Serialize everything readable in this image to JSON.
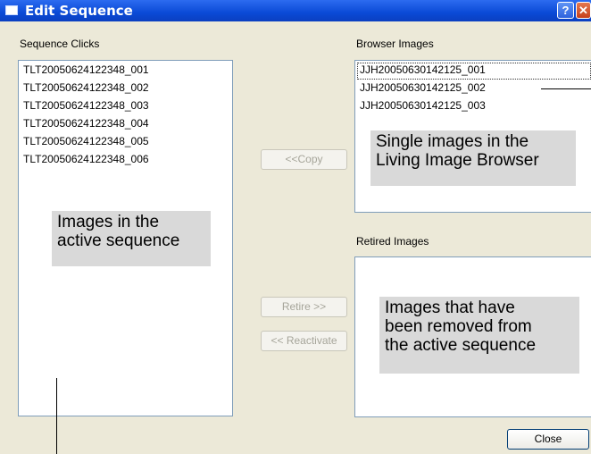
{
  "window": {
    "title": "Edit Sequence",
    "help_glyph": "?",
    "close_glyph": "✕"
  },
  "sequence_clicks": {
    "label": "Sequence Clicks",
    "items": [
      "TLT20050624122348_001",
      "TLT20050624122348_002",
      "TLT20050624122348_003",
      "TLT20050624122348_004",
      "TLT20050624122348_005",
      "TLT20050624122348_006"
    ]
  },
  "browser_images": {
    "label": "Browser Images",
    "items": [
      "JJH20050630142125_001",
      "JJH20050630142125_002",
      "JJH20050630142125_003"
    ]
  },
  "retired_images": {
    "label": "Retired Images",
    "items": []
  },
  "buttons": {
    "copy": "<<Copy",
    "retire": "Retire >>",
    "reactivate": "<< Reactivate",
    "close": "Close"
  },
  "callouts": {
    "sequence": [
      "Images in the",
      "active sequence"
    ],
    "browser": [
      "Single images in the",
      "Living Image Browser"
    ],
    "retired": [
      "Images that have",
      "been removed from",
      "the active sequence"
    ]
  },
  "colors": {
    "title_bar": "#0a4ad6",
    "window_bg": "#ece9d8",
    "callout_bg": "#d9d9d9",
    "list_border": "#7f9db9"
  }
}
